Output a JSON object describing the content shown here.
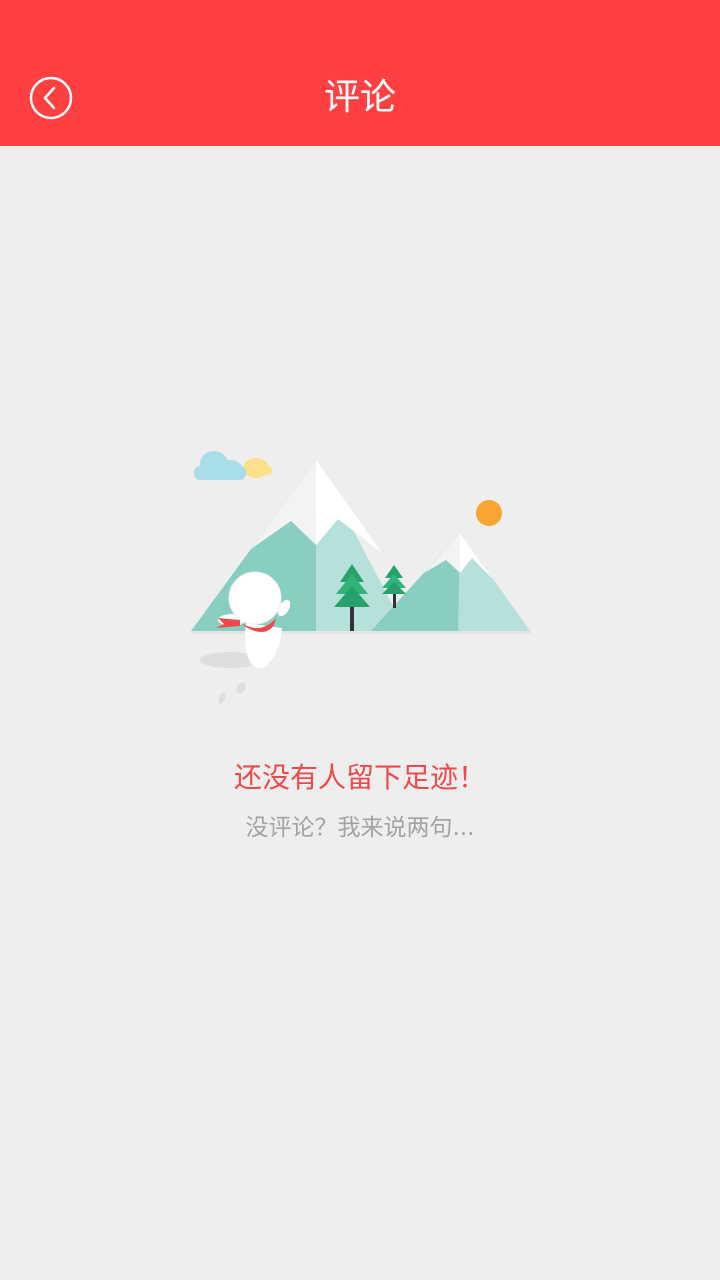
{
  "header": {
    "title": "评论",
    "back_icon": "chevron-left-circle-icon"
  },
  "empty_state": {
    "illustration": "mountain-scene-illustration",
    "title": "还没有人留下足迹！",
    "subtitle": "没评论？我来说两句..."
  },
  "colors": {
    "header_bg": "#ff4043",
    "page_bg": "#eeeeee",
    "title_red": "#f0484b",
    "subtitle_gray": "#a3a3a3"
  }
}
